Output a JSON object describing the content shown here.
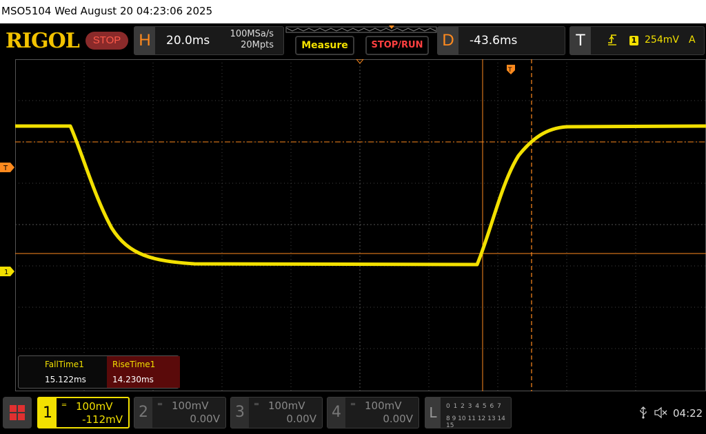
{
  "title": "MSO5104  Wed August 20 04:23:06 2025",
  "brand": "RIGOL",
  "status": "STOP",
  "horizontal": {
    "letter": "H",
    "scale": "20.0ms",
    "sample_rate": "100MSa/s",
    "memory_depth": "20Mpts"
  },
  "buttons": {
    "measure": "Measure",
    "stop_run": "STOP/RUN"
  },
  "delay": {
    "letter": "D",
    "value": "-43.6ms"
  },
  "trigger": {
    "letter": "T",
    "edge_icon": "rising-edge-icon",
    "channel": "1",
    "level": "254mV",
    "mode": "A"
  },
  "markers": {
    "trigger_level": "T",
    "channel1": "1"
  },
  "measurements": [
    {
      "label": "FallTime1",
      "value": "15.122ms"
    },
    {
      "label": "RiseTime1",
      "value": "14.230ms"
    }
  ],
  "channels": [
    {
      "num": "1",
      "scale": "100mV",
      "offset": "-112mV",
      "active": true
    },
    {
      "num": "2",
      "scale": "100mV",
      "offset": "0.00V",
      "active": false
    },
    {
      "num": "3",
      "scale": "100mV",
      "offset": "0.00V",
      "active": false
    },
    {
      "num": "4",
      "scale": "100mV",
      "offset": "0.00V",
      "active": false
    }
  ],
  "logic": {
    "letter": "L",
    "row1": "0 1 2 3  4 5 6 7",
    "row2": "8 9 10 11 12 13 14 15"
  },
  "clock": "04:22",
  "colors": {
    "ch1": "#f2e000",
    "accent": "#ff8a1e",
    "stop": "#ff4040",
    "brand": "#f2c200"
  }
}
